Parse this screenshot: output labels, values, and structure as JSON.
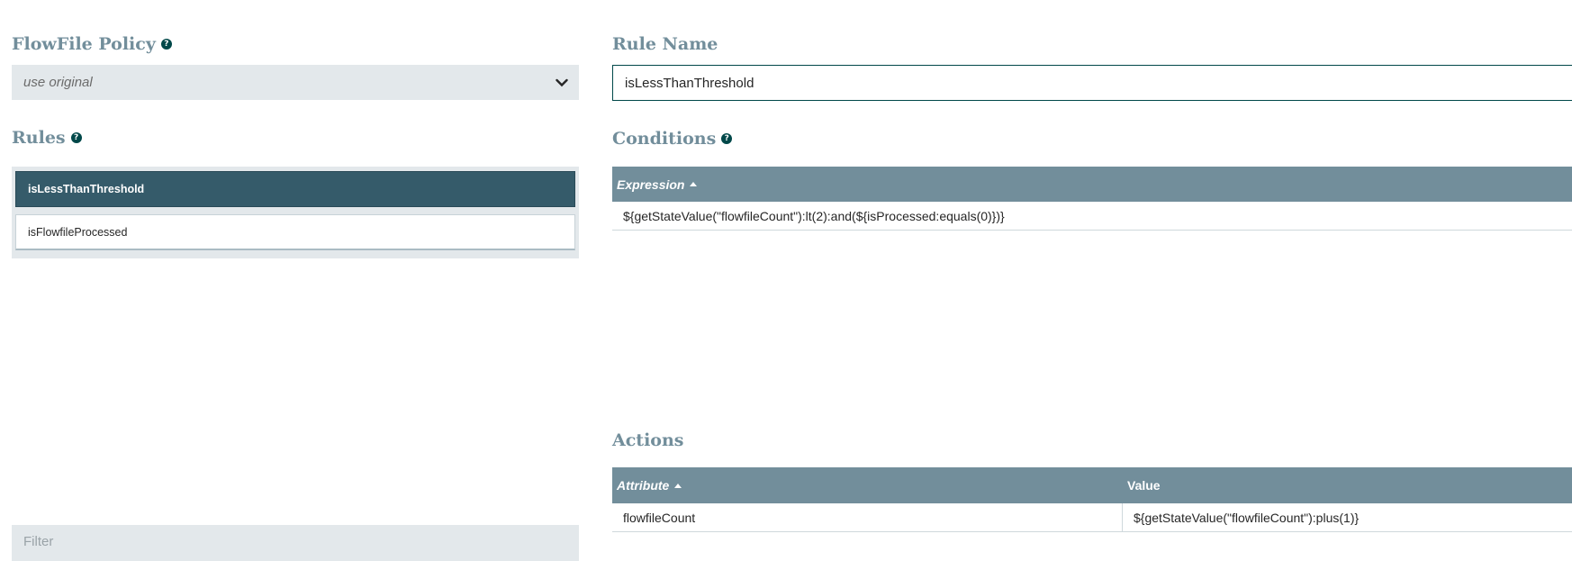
{
  "left_panel": {
    "policy_title": "FlowFile Policy",
    "policy_value": "use original",
    "rules_title": "Rules",
    "rules": [
      {
        "label": "isLessThanThreshold"
      },
      {
        "label": "isFlowfileProcessed"
      }
    ],
    "filter_placeholder": "Filter"
  },
  "right_panel": {
    "rule_name_title": "Rule Name",
    "rule_name_value": "isLessThanThreshold",
    "conditions_title": "Conditions",
    "conditions_header": "Expression",
    "conditions_rows": [
      {
        "expression": "${getStateValue(\"flowfileCount\"):lt(2):and(${isProcessed:equals(0)})}"
      }
    ],
    "actions_title": "Actions",
    "actions_headers": {
      "attribute": "Attribute",
      "value": "Value"
    },
    "actions_rows": [
      {
        "attribute": "flowfileCount",
        "value": "${getStateValue(\"flowfileCount\"):plus(1)}"
      }
    ]
  },
  "colors": {
    "title": "#728e9b",
    "header_bg": "#728e9b",
    "selected_bg": "#355b6a",
    "panel_bg": "#e3e8eb",
    "help_icon": "#004849"
  }
}
